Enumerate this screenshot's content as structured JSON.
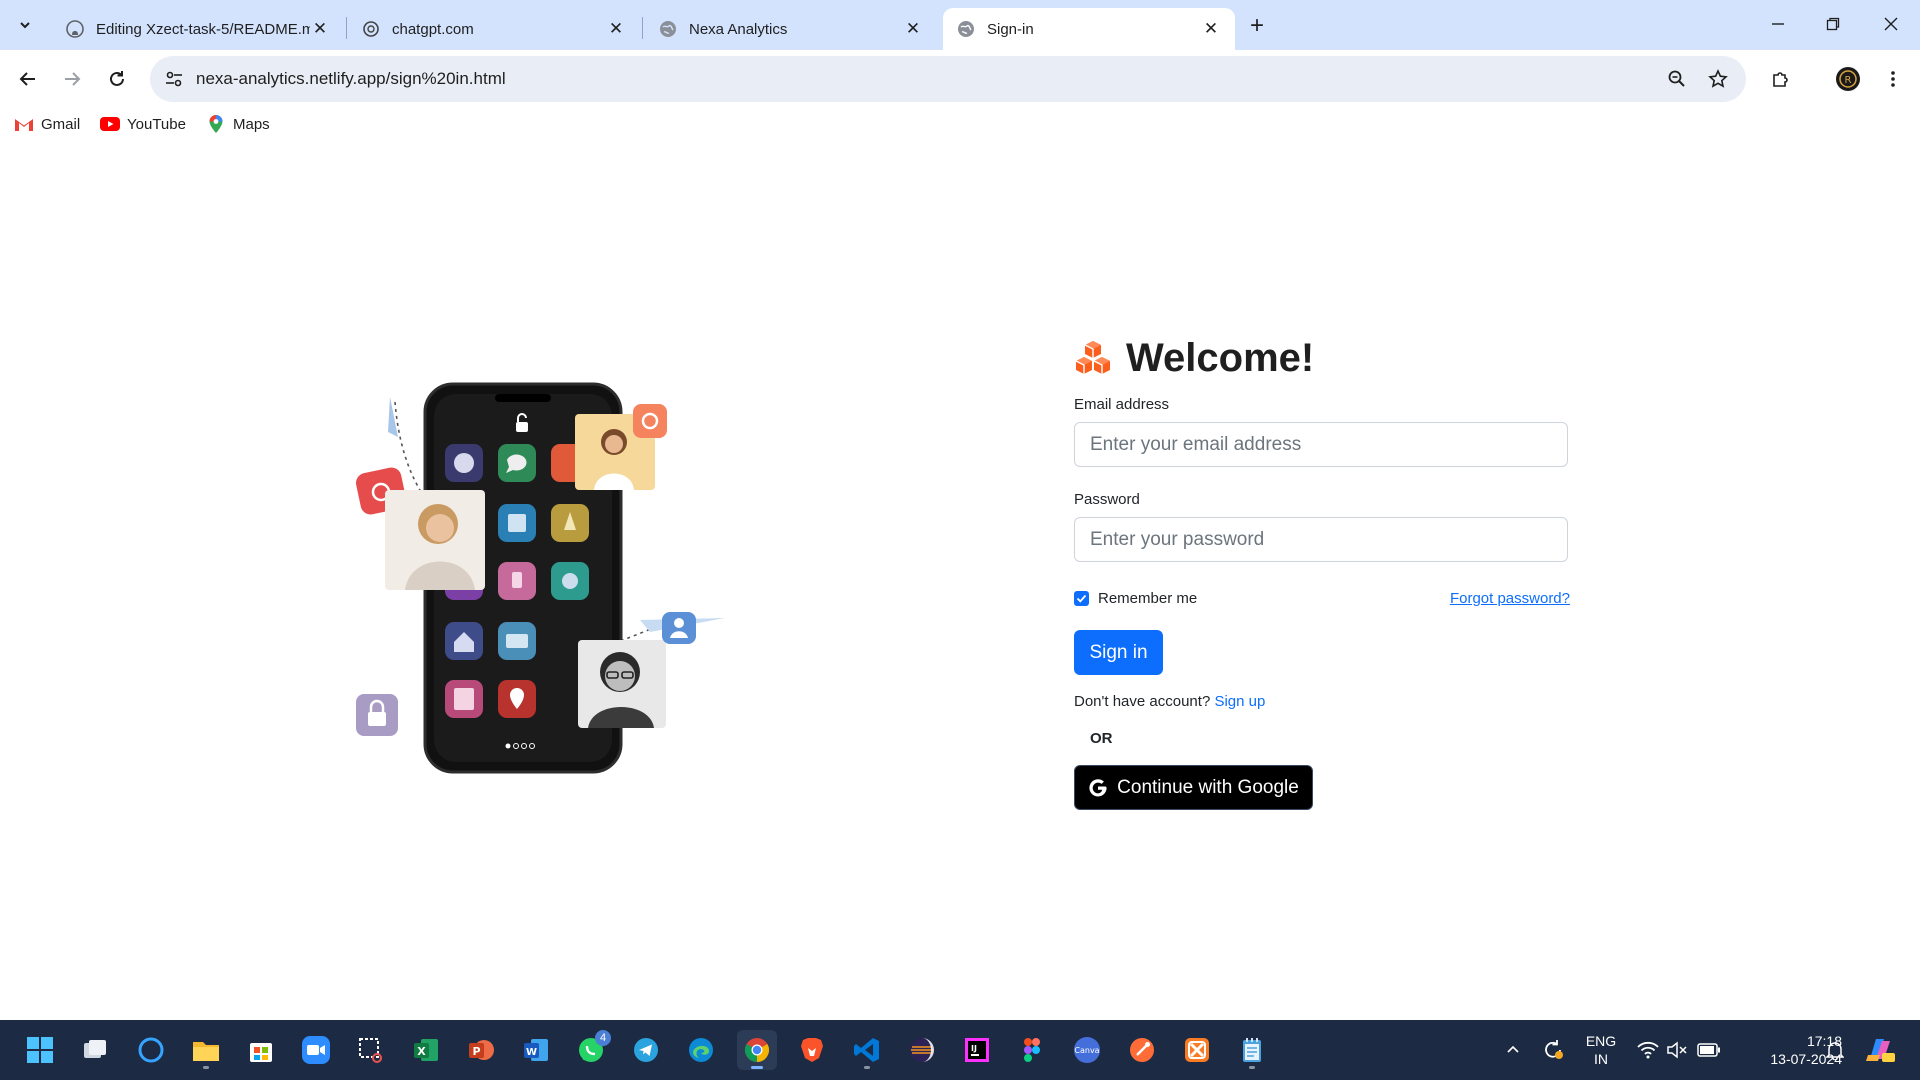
{
  "browser": {
    "tabs": [
      {
        "title": "Editing Xzect-task-5/README.m",
        "icon": "github-icon",
        "active": false
      },
      {
        "title": "chatgpt.com",
        "icon": "chatgpt-icon",
        "active": false
      },
      {
        "title": "Nexa Analytics",
        "icon": "globe-icon",
        "active": false
      },
      {
        "title": "Sign-in",
        "icon": "globe-icon",
        "active": true
      }
    ],
    "url": "nexa-analytics.netlify.app/sign%20in.html",
    "bookmarks": [
      {
        "label": "Gmail",
        "icon": "gmail-icon"
      },
      {
        "label": "YouTube",
        "icon": "youtube-icon"
      },
      {
        "label": "Maps",
        "icon": "maps-icon"
      }
    ]
  },
  "login": {
    "title": "Welcome!",
    "email_label": "Email address",
    "email_placeholder": "Enter your email address",
    "email_value": "",
    "password_label": "Password",
    "password_placeholder": "Enter your password",
    "password_value": "",
    "remember_label": "Remember me",
    "remember_checked": true,
    "forgot_label": "Forgot password?",
    "signin_label": "Sign in",
    "no_account_text": "Don't have account?",
    "signup_label": "Sign up",
    "or_text": "OR",
    "google_label": "Continue with Google"
  },
  "colors": {
    "primary": "#0d6efd",
    "logo_orange": "#fc5f1d",
    "tabbar": "#d3e3fd",
    "taskbar": "#1c2b43"
  },
  "taskbar": {
    "apps": [
      "windows-start-icon",
      "task-view-icon",
      "cortana-icon",
      "file-explorer-icon",
      "microsoft-store-icon",
      "zoom-icon",
      "snipping-tool-icon",
      "excel-icon",
      "powerpoint-icon",
      "word-icon",
      "whatsapp-icon",
      "telegram-icon",
      "edge-icon",
      "chrome-icon",
      "brave-icon",
      "vscode-icon",
      "eclipse-icon",
      "intellij-icon",
      "figma-icon",
      "canva-icon",
      "postman-icon",
      "xampp-icon",
      "notepad-icon"
    ],
    "whatsapp_badge": "4",
    "lang_line1": "ENG",
    "lang_line2": "IN",
    "time": "17:18",
    "date": "13-07-2024"
  }
}
